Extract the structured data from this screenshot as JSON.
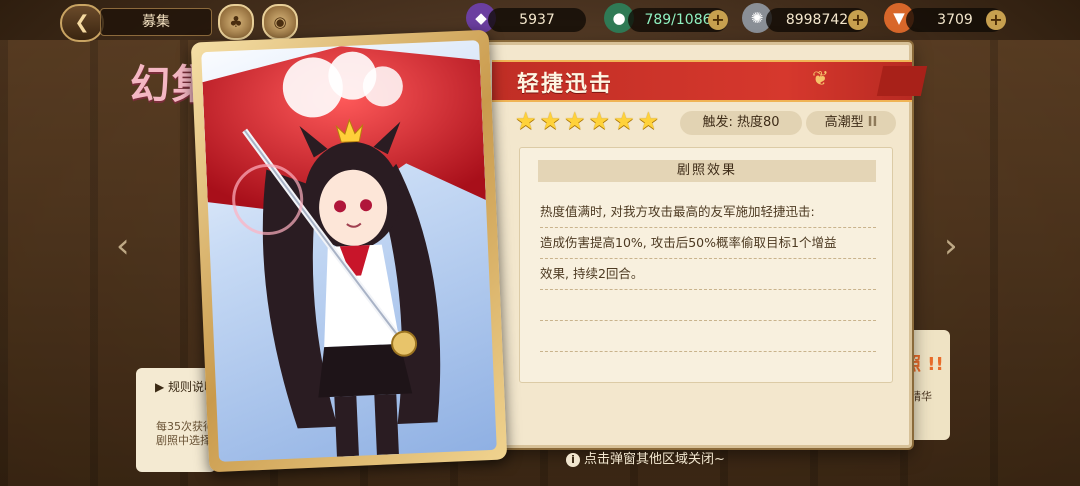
{
  "top_bar": {
    "title": "募集",
    "resource_1": {
      "value": "5937",
      "icon": "purple-crystal-icon"
    },
    "resource_2": {
      "value": "789/1086",
      "icon": "stamina-potion-icon"
    },
    "resource_3": {
      "value": "8998742",
      "icon": "silver-coin-icon"
    },
    "resource_4": {
      "value": "3709",
      "icon": "carrot-icon"
    },
    "plus_label": "+"
  },
  "background": {
    "side_title": "幻集",
    "rules_label": "▶ 规则说明",
    "note": "每35次获得 剧照中选择",
    "right_text_top": "情",
    "right_text_hi": "照 !!",
    "right_text_low": "获精华"
  },
  "skill": {
    "name": "轻捷迅击",
    "stars": 6,
    "star_glyph": "★",
    "trigger": "触发: 热度80",
    "type": "高潮型",
    "type_level": "II"
  },
  "effect": {
    "header": "剧照效果",
    "lines": [
      "热度值满时, 对我方攻击最高的友军施加轻捷迅击:",
      "造成伤害提高10%, 攻击后50%概率偷取目标1个增益",
      "效果, 持续2回合。",
      "",
      ""
    ]
  },
  "footer": {
    "hint": "点击弹窗其他区域关闭~",
    "info_glyph": "i"
  },
  "nav": {
    "left_arrow": "‹",
    "right_arrow": "›"
  },
  "colors": {
    "banner_red": "#d6382d",
    "star_gold": "#ffd23a",
    "panel_cream": "#f3e7cd"
  }
}
